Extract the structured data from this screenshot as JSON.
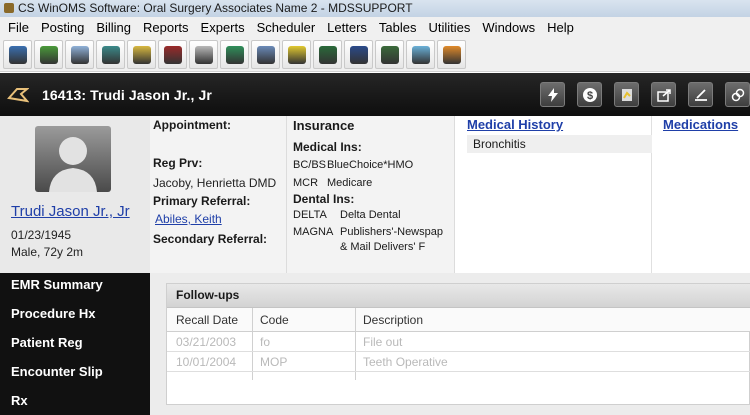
{
  "window": {
    "title": "CS WinOMS Software: Oral Surgery Associates Name 2 - MDSSUPPORT"
  },
  "menu": [
    "File",
    "Posting",
    "Billing",
    "Reports",
    "Experts",
    "Scheduler",
    "Letters",
    "Tables",
    "Utilities",
    "Windows",
    "Help"
  ],
  "toolbar": {
    "icons": [
      {
        "name": "patient-icon",
        "color": "#3a6fb0"
      },
      {
        "name": "tree-icon",
        "color": "#4a9a3a"
      },
      {
        "name": "search-doc-icon",
        "color": "#8fb0d8"
      },
      {
        "name": "payment-icon",
        "color": "#3b8a8a"
      },
      {
        "name": "sticky-note-icon",
        "color": "#d8b840"
      },
      {
        "name": "chess-icon",
        "color": "#9a2a2a"
      },
      {
        "name": "notes-icon",
        "color": "#b8b8b8"
      },
      {
        "name": "exit-door-icon",
        "color": "#2f8f5a"
      },
      {
        "name": "form-icon",
        "color": "#6a8ab8"
      },
      {
        "name": "sun-calendar-icon",
        "color": "#e0c830"
      },
      {
        "name": "book-icon",
        "color": "#2a6a3a"
      },
      {
        "name": "windows-icon",
        "color": "#2a4a8a"
      },
      {
        "name": "letters-icon",
        "color": "#3a6a3a"
      },
      {
        "name": "refresh-icon",
        "color": "#6ab0d8"
      },
      {
        "name": "logout-icon",
        "color": "#e08a2a"
      }
    ]
  },
  "patient": {
    "header": "16413: Trudi Jason Jr., Jr",
    "name": "Trudi Jason Jr., Jr",
    "dob": "01/23/1945",
    "sex_age": "Male, 72y 2m"
  },
  "header_actions": [
    "lightning-icon",
    "dollar-icon",
    "chart-icon",
    "export-icon",
    "sign-icon",
    "link-icon"
  ],
  "appointment": {
    "label": "Appointment:",
    "reg_prv_label": "Reg Prv:",
    "reg_prv": "Jacoby, Henrietta DMD",
    "primary_ref_label": "Primary Referral:",
    "primary_ref": "Abiles, Keith",
    "secondary_ref_label": "Secondary Referral:"
  },
  "insurance": {
    "label": "Insurance",
    "medical_label": "Medical Ins:",
    "medical": [
      {
        "code": "BC/BS",
        "name": "BlueChoice*HMO"
      },
      {
        "code": "MCR",
        "name": "Medicare"
      }
    ],
    "dental_label": "Dental Ins:",
    "dental": [
      {
        "code": "DELTA",
        "name": "Delta Dental"
      },
      {
        "code": "MAGNA",
        "name": "Publishers'-Newspap"
      }
    ],
    "dental_cont": "& Mail Delivers' F"
  },
  "medical_history": {
    "label": "Medical History",
    "items": [
      "Bronchitis"
    ]
  },
  "medications": {
    "label": "Medications"
  },
  "nav": [
    "EMR Summary",
    "Procedure Hx",
    "Patient Reg",
    "Encounter Slip",
    "Rx"
  ],
  "followups": {
    "title": "Follow-ups",
    "columns": [
      "Recall Date",
      "Code",
      "Description"
    ],
    "rows": [
      {
        "date": "03/21/2003",
        "code": "fo",
        "desc": "File out"
      },
      {
        "date": "10/01/2004",
        "code": "MOP",
        "desc": "Teeth Operative"
      }
    ]
  }
}
